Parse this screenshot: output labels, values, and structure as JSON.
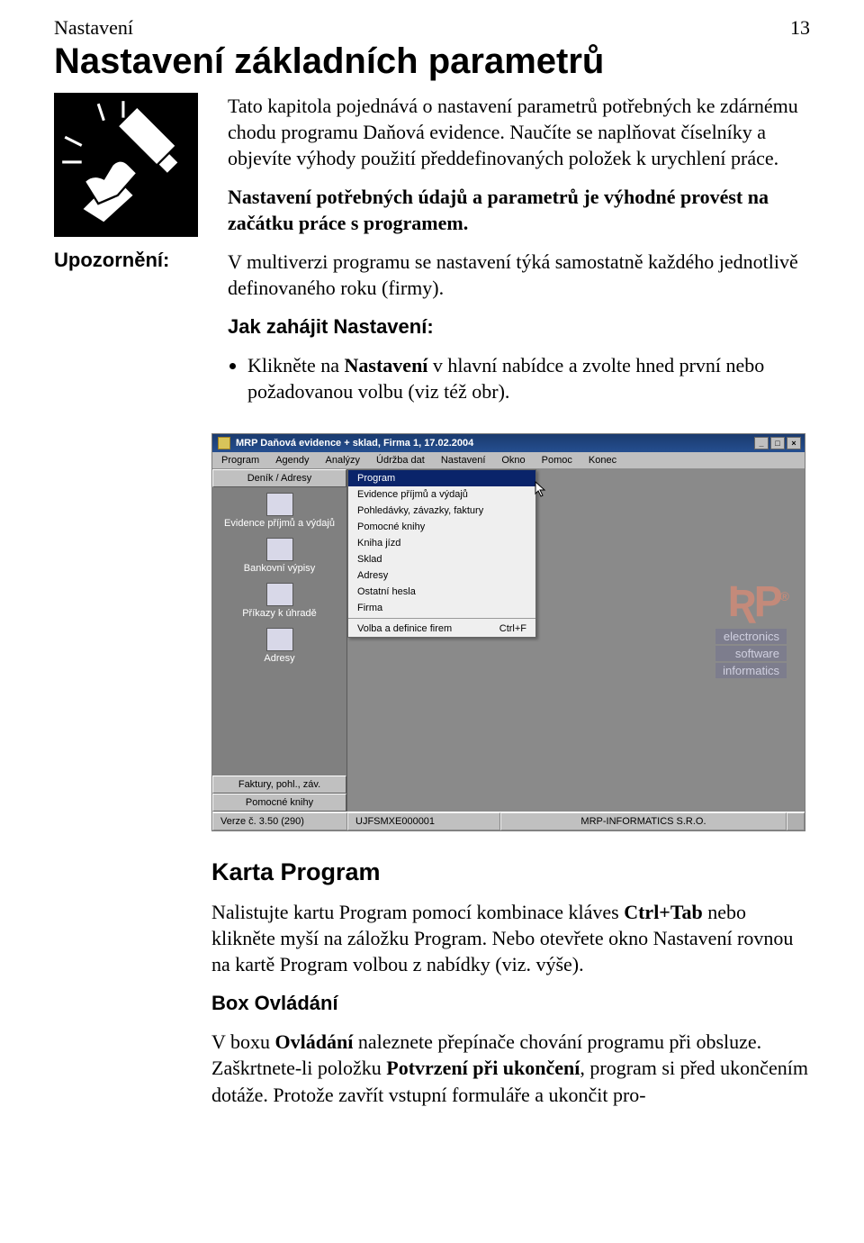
{
  "header": {
    "left": "Nastavení",
    "right": "13"
  },
  "title": "Nastavení základních parametrů",
  "intro": {
    "p1": "Tato kapitola pojednává o nastavení parametrů potřebných ke zdárnému chodu programu Daňová evidence. Naučíte se naplňovat číselníky a objevíte výhody použití předdefinovaných položek k urychlení práce.",
    "p2": "Nastavení potřebných údajů a parametrů je výhodné provést na začátku práce s programem."
  },
  "warning": {
    "label": "Upozornění:",
    "text": "V multiverzi programu se nastavení týká samostatně každého jednotlivě definovaného roku (firmy)."
  },
  "howto": {
    "heading": "Jak zahájit Nastavení:",
    "bullet_pre": "Klikněte na ",
    "bullet_b": "Nastavení",
    "bullet_post": " v hlavní nabídce a zvolte hned první nebo požadovanou volbu (viz též obr)."
  },
  "screenshot": {
    "title": "MRP Daňová evidence + sklad, Firma 1, 17.02.2004",
    "menus": [
      "Program",
      "Agendy",
      "Analýzy",
      "Údržba dat",
      "Nastavení",
      "Okno",
      "Pomoc",
      "Konec"
    ],
    "sidebar": {
      "top_tab": "Deník / Adresy",
      "items": [
        "Evidence příjmů a výdajů",
        "Bankovní výpisy",
        "Příkazy k úhradě",
        "Adresy"
      ],
      "bottom_tabs": [
        "Faktury, pohl., záv.",
        "Pomocné knihy"
      ]
    },
    "dropdown": {
      "items": [
        "Program",
        "Evidence příjmů a výdajů",
        "Pohledávky, závazky, faktury",
        "Pomocné knihy",
        "Kniha jízd",
        "Sklad",
        "Adresy",
        "Ostatní hesla",
        "Firma"
      ],
      "sep_item": "Volba a definice firem",
      "shortcut": "Ctrl+F"
    },
    "watermark_tags": [
      "electronics",
      "software",
      "informatics"
    ],
    "status": {
      "version": "Verze č. 3.50 (290)",
      "code": "UJFSMXE000001",
      "company": "MRP-INFORMATICS S.R.O."
    }
  },
  "section2": {
    "title": "Karta Program",
    "p1_pre": "Nalistujte kartu Program pomocí kombinace kláves ",
    "p1_b": "Ctrl+Tab",
    "p1_post": " nebo klikněte myší na záložku Program. Nebo otevřete okno Nastavení rovnou na kartě Program volbou z nabídky (viz. výše).",
    "sub": "Box Ovládání",
    "p2_pre": "V boxu ",
    "p2_b1": "Ovládání",
    "p2_mid1": " naleznete přepínače chování programu při obsluze. Zaškrtnete-li položku ",
    "p2_b2": "Potvrzení při ukončení",
    "p2_mid2": ", program si před ukončením dotáže. Protože zavřít vstupní formuláře a ukončit pro-"
  }
}
